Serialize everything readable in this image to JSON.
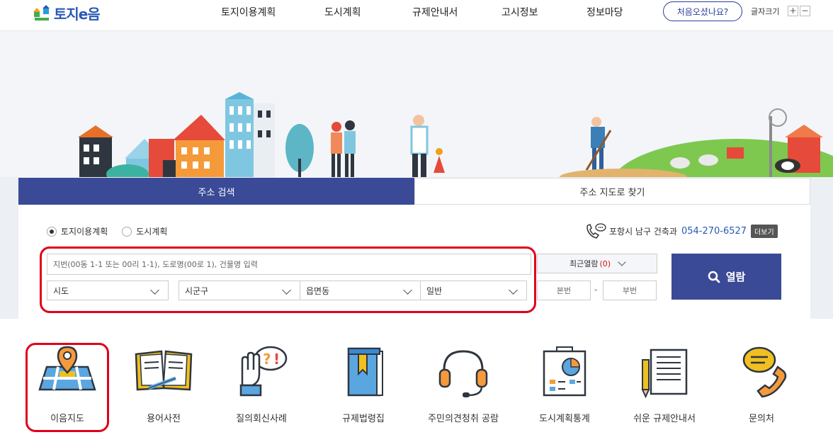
{
  "header": {
    "logo_text": "토지e음",
    "nav": [
      "토지이용계획",
      "도시계획",
      "규제안내서",
      "고시정보",
      "정보마당"
    ],
    "first_visit": "처음오셨나요?",
    "font_size_label": "글자크기",
    "font_plus": "+",
    "font_minus": "−"
  },
  "search": {
    "tabs": [
      "주소 검색",
      "주소 지도로 찾기"
    ],
    "radios": [
      {
        "label": "토지이용계획",
        "checked": true
      },
      {
        "label": "도시계획",
        "checked": false
      }
    ],
    "contact_text": "포항시 남구 건축과",
    "contact_phone": "054-270-6527",
    "more": "더보기",
    "address_placeholder": "지번(00동 1-1 또는 00리 1-1), 도로명(00로 1), 건물명 입력",
    "selects": [
      "시도",
      "시군구",
      "읍면동",
      "일반"
    ],
    "recent_label": "최근열람",
    "recent_count": "(0)",
    "main_no": "본번",
    "dash": "-",
    "sub_no": "부번",
    "search_button": "열람"
  },
  "menu": [
    {
      "label": "이음지도",
      "icon": "map-pin-icon"
    },
    {
      "label": "용어사전",
      "icon": "open-book-icon"
    },
    {
      "label": "질의회신사례",
      "icon": "hand-question-icon"
    },
    {
      "label": "규제법령집",
      "icon": "law-book-icon"
    },
    {
      "label": "주민의견청취 공람",
      "icon": "headset-icon"
    },
    {
      "label": "도시계획통계",
      "icon": "chart-board-icon"
    },
    {
      "label": "쉬운 규제안내서",
      "icon": "document-pencil-icon"
    },
    {
      "label": "문의처",
      "icon": "phone-chat-icon"
    }
  ],
  "colors": {
    "primary": "#3a4a96",
    "highlight": "#e0001b",
    "link": "#2b58b5"
  }
}
